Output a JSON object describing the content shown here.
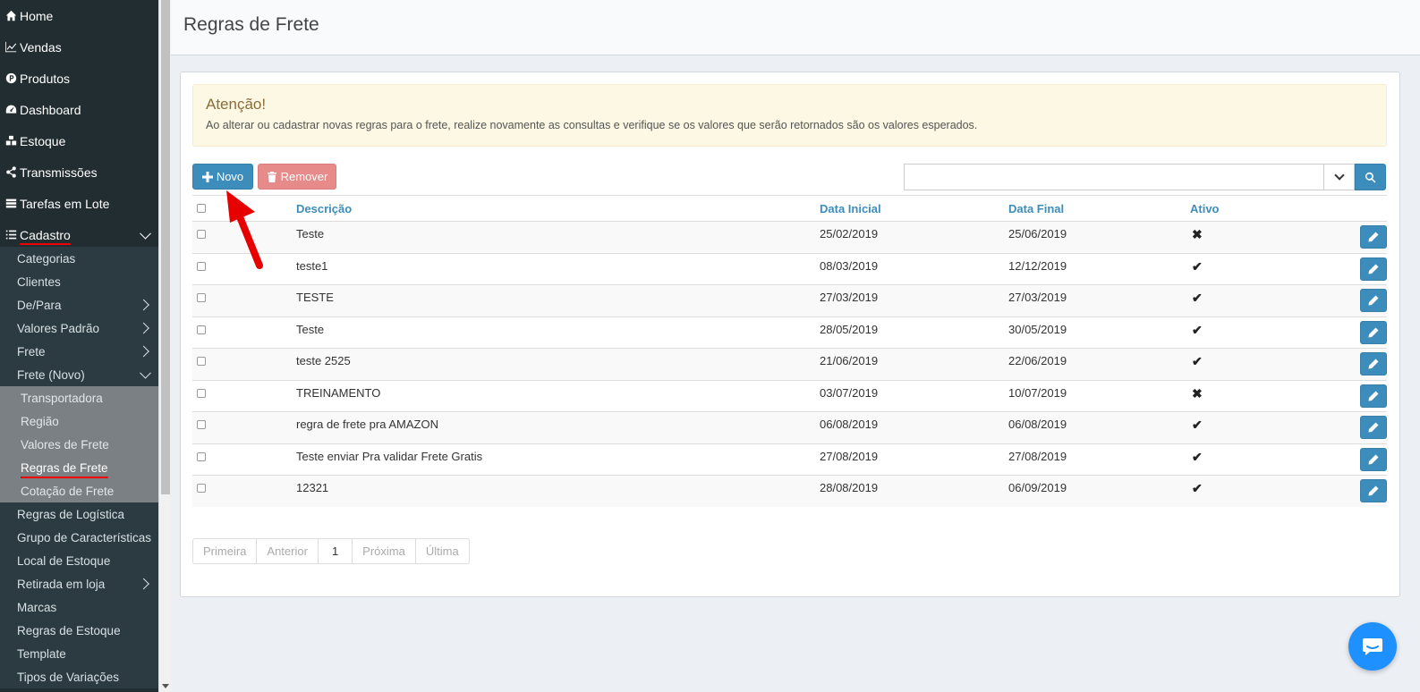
{
  "sidebar": {
    "top_items": [
      {
        "label": "Home",
        "icon": "home-icon"
      },
      {
        "label": "Vendas",
        "icon": "chart-line-icon"
      },
      {
        "label": "Produtos",
        "icon": "product-icon"
      },
      {
        "label": "Dashboard",
        "icon": "dashboard-icon"
      },
      {
        "label": "Estoque",
        "icon": "cubes-icon"
      },
      {
        "label": "Transmissões",
        "icon": "share-icon"
      },
      {
        "label": "Tarefas em Lote",
        "icon": "tasks-icon"
      },
      {
        "label": "Cadastro",
        "icon": "list-icon"
      }
    ],
    "sub_items_a": [
      "Categorias",
      "Clientes",
      "De/Para",
      "Valores Padrão",
      "Frete",
      "Frete (Novo)"
    ],
    "sub2_items": [
      "Transportadora",
      "Região",
      "Valores de Frete",
      "Regras de Frete",
      "Cotação de Frete"
    ],
    "sub_items_b": [
      "Regras de Logística",
      "Grupo de Características",
      "Local de Estoque",
      "Retirada em loja",
      "Marcas",
      "Regras de Estoque",
      "Template",
      "Tipos de Variações"
    ]
  },
  "page": {
    "title": "Regras de Frete"
  },
  "alert": {
    "title": "Atenção!",
    "text": "Ao alterar ou cadastrar novas regras para o frete, realize novamente as consultas e verifique se os valores que serão retornados são os valores esperados."
  },
  "toolbar": {
    "new_label": "Novo",
    "remove_label": "Remover",
    "search_value": ""
  },
  "table": {
    "headers": {
      "description": "Descrição",
      "start_date": "Data Inicial",
      "end_date": "Data Final",
      "active": "Ativo"
    },
    "rows": [
      {
        "description": "Teste",
        "start": "25/02/2019",
        "end": "25/06/2019",
        "active": "✖"
      },
      {
        "description": "teste1",
        "start": "08/03/2019",
        "end": "12/12/2019",
        "active": "✔"
      },
      {
        "description": "TESTE",
        "start": "27/03/2019",
        "end": "27/03/2019",
        "active": "✔"
      },
      {
        "description": "Teste",
        "start": "28/05/2019",
        "end": "30/05/2019",
        "active": "✔"
      },
      {
        "description": "teste 2525",
        "start": "21/06/2019",
        "end": "22/06/2019",
        "active": "✔"
      },
      {
        "description": "TREINAMENTO",
        "start": "03/07/2019",
        "end": "10/07/2019",
        "active": "✖"
      },
      {
        "description": "regra de frete pra AMAZON",
        "start": "06/08/2019",
        "end": "06/08/2019",
        "active": "✔"
      },
      {
        "description": "Teste enviar Pra validar Frete Gratis",
        "start": "27/08/2019",
        "end": "27/08/2019",
        "active": "✔"
      },
      {
        "description": "12321",
        "start": "28/08/2019",
        "end": "06/09/2019",
        "active": "✔"
      }
    ]
  },
  "pagination": {
    "first": "Primeira",
    "prev": "Anterior",
    "current": "1",
    "next": "Próxima",
    "last": "Última"
  },
  "colors": {
    "sidebar_bg": "#222d32",
    "primary": "#3c8dbc",
    "danger_light": "#e78a8a",
    "alert_bg": "#fcf8e3",
    "annotation_red": "#e60000"
  }
}
